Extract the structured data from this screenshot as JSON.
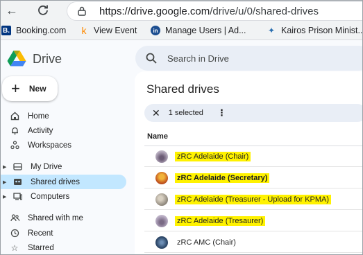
{
  "browser": {
    "url_host": "https://drive.google.com",
    "url_path": "/drive/u/0/shared-drives"
  },
  "bookmarks": [
    {
      "label": "Booking.com",
      "favicon": "booking-favicon",
      "color": "#003580",
      "glyph": "B."
    },
    {
      "label": "View Event",
      "favicon": "event-favicon",
      "color": "#ff8a00",
      "glyph": "k"
    },
    {
      "label": "Manage Users | Ad...",
      "favicon": "in-favicon",
      "color": "#1d4f91",
      "glyph": "in"
    },
    {
      "label": "Kairos Prison Minist...",
      "favicon": "kairos-favicon",
      "color": "#2a6fb0",
      "glyph": "✦"
    }
  ],
  "drive": {
    "title": "Drive",
    "search_placeholder": "Search in Drive",
    "new_label": "New"
  },
  "sidebar": {
    "items": [
      {
        "label": "Home",
        "icon": "home-icon"
      },
      {
        "label": "Activity",
        "icon": "bell-icon"
      },
      {
        "label": "Workspaces",
        "icon": "workspaces-icon"
      },
      {
        "label": "My Drive",
        "icon": "my-drive-icon"
      },
      {
        "label": "Shared drives",
        "icon": "shared-drives-icon",
        "active": true
      },
      {
        "label": "Computers",
        "icon": "computer-icon"
      },
      {
        "label": "Shared with me",
        "icon": "people-icon"
      },
      {
        "label": "Recent",
        "icon": "clock-icon"
      },
      {
        "label": "Starred",
        "icon": "star-icon"
      }
    ]
  },
  "main": {
    "title": "Shared drives",
    "selection": {
      "count_text": "1 selected"
    },
    "column_name": "Name",
    "highlight_color": "#fff200",
    "rows": [
      {
        "name": "zRC Adelaide (Chair)",
        "highlighted": true,
        "avatar_color": "#b0a5b8"
      },
      {
        "name": "zRC Adelaide (Secretary)",
        "highlighted": true,
        "avatar_color": "#c2541f"
      },
      {
        "name": "zRC Adelaide (Treasurer - Upload for KPMA)",
        "highlighted": true,
        "avatar_color": "#8c857a"
      },
      {
        "name": "zRC Adelaide (Tresaurer)",
        "highlighted": true,
        "avatar_color": "#b4a8bf"
      },
      {
        "name": "zRC AMC (Chair)",
        "highlighted": false,
        "avatar_color": "#2f4a6b"
      }
    ]
  }
}
